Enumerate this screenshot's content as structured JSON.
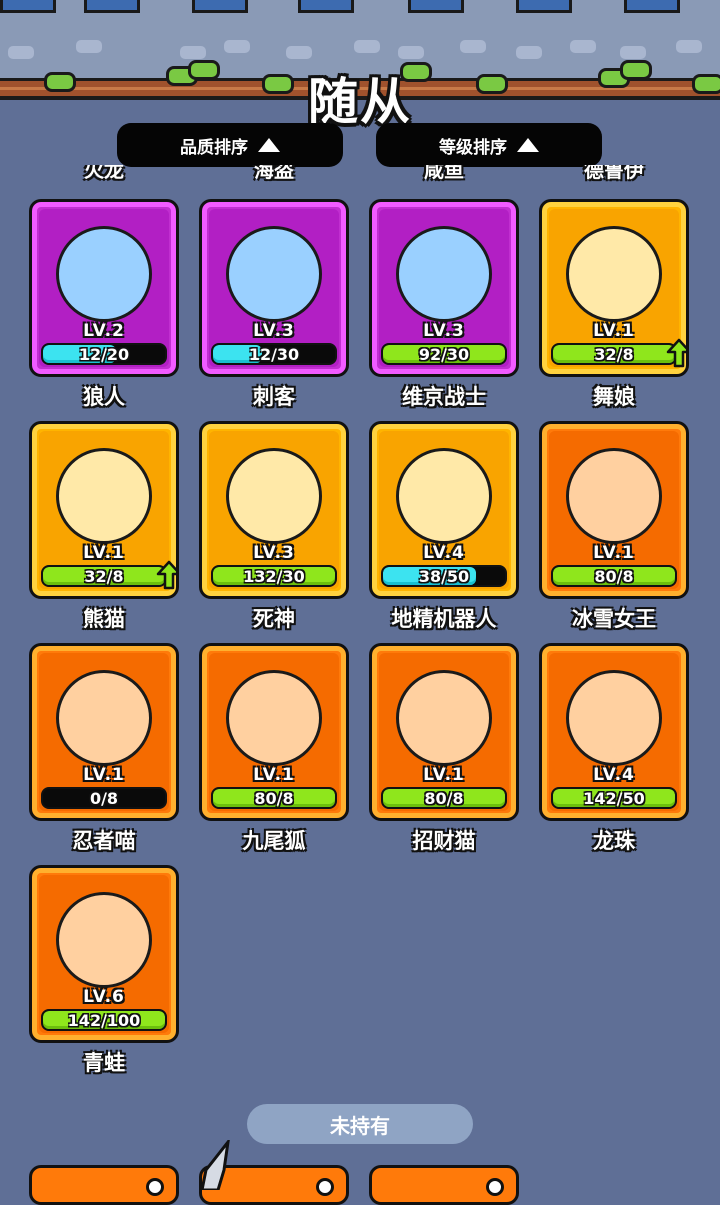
{
  "header": {
    "title": "随从"
  },
  "sort": {
    "quality_label": "品质排序",
    "level_label": "等级排序"
  },
  "previous_row_names": [
    "火龙",
    "海盗",
    "咸鱼",
    "德鲁伊"
  ],
  "owned": [
    {
      "name": "狼人",
      "level": "LV.2",
      "progress": "12/20",
      "frame": "purple",
      "bar": "cyan",
      "fraction": 0.6,
      "upgrade": false,
      "icon": "werewolf-icon"
    },
    {
      "name": "刺客",
      "level": "LV.3",
      "progress": "12/30",
      "frame": "purple",
      "bar": "cyan",
      "fraction": 0.4,
      "upgrade": false,
      "icon": "assassin-icon"
    },
    {
      "name": "维京战士",
      "level": "LV.3",
      "progress": "92/30",
      "frame": "purple",
      "bar": "green",
      "fraction": 1,
      "upgrade": false,
      "icon": "viking-icon"
    },
    {
      "name": "舞娘",
      "level": "LV.1",
      "progress": "32/8",
      "frame": "yellow",
      "bar": "green",
      "fraction": 1,
      "upgrade": true,
      "icon": "dancer-icon"
    },
    {
      "name": "熊猫",
      "level": "LV.1",
      "progress": "32/8",
      "frame": "yellow",
      "bar": "green",
      "fraction": 1,
      "upgrade": true,
      "icon": "panda-icon"
    },
    {
      "name": "死神",
      "level": "LV.3",
      "progress": "132/30",
      "frame": "yellow",
      "bar": "green",
      "fraction": 1,
      "upgrade": false,
      "icon": "reaper-icon"
    },
    {
      "name": "地精机器人",
      "level": "LV.4",
      "progress": "38/50",
      "frame": "yellow",
      "bar": "cyan",
      "fraction": 0.76,
      "upgrade": false,
      "icon": "goblin-robot-icon"
    },
    {
      "name": "冰雪女王",
      "level": "LV.1",
      "progress": "80/8",
      "frame": "orange",
      "bar": "green",
      "fraction": 1,
      "upgrade": false,
      "icon": "ice-queen-icon"
    },
    {
      "name": "忍者喵",
      "level": "LV.1",
      "progress": "0/8",
      "frame": "orange",
      "bar": "green",
      "fraction": 0,
      "upgrade": false,
      "icon": "ninja-cat-icon"
    },
    {
      "name": "九尾狐",
      "level": "LV.1",
      "progress": "80/8",
      "frame": "orange",
      "bar": "green",
      "fraction": 1,
      "upgrade": false,
      "icon": "nine-tailed-fox-icon"
    },
    {
      "name": "招财猫",
      "level": "LV.1",
      "progress": "80/8",
      "frame": "orange",
      "bar": "green",
      "fraction": 1,
      "upgrade": false,
      "icon": "lucky-cat-icon"
    },
    {
      "name": "龙珠",
      "level": "LV.4",
      "progress": "142/50",
      "frame": "orange",
      "bar": "green",
      "fraction": 1,
      "upgrade": false,
      "icon": "dragon-orb-icon"
    },
    {
      "name": "青蛙",
      "level": "LV.6",
      "progress": "142/100",
      "frame": "orange",
      "bar": "green",
      "fraction": 1,
      "upgrade": false,
      "icon": "frog-icon"
    }
  ],
  "unowned_section": {
    "label": "未持有"
  },
  "colors": {
    "background": "#5f6f96",
    "purple_frame": "#c12fd0",
    "yellow_frame": "#ffb400",
    "orange_frame": "#ff7a0a",
    "bar_green": "#8fe61c",
    "bar_cyan": "#3ce3f0"
  }
}
